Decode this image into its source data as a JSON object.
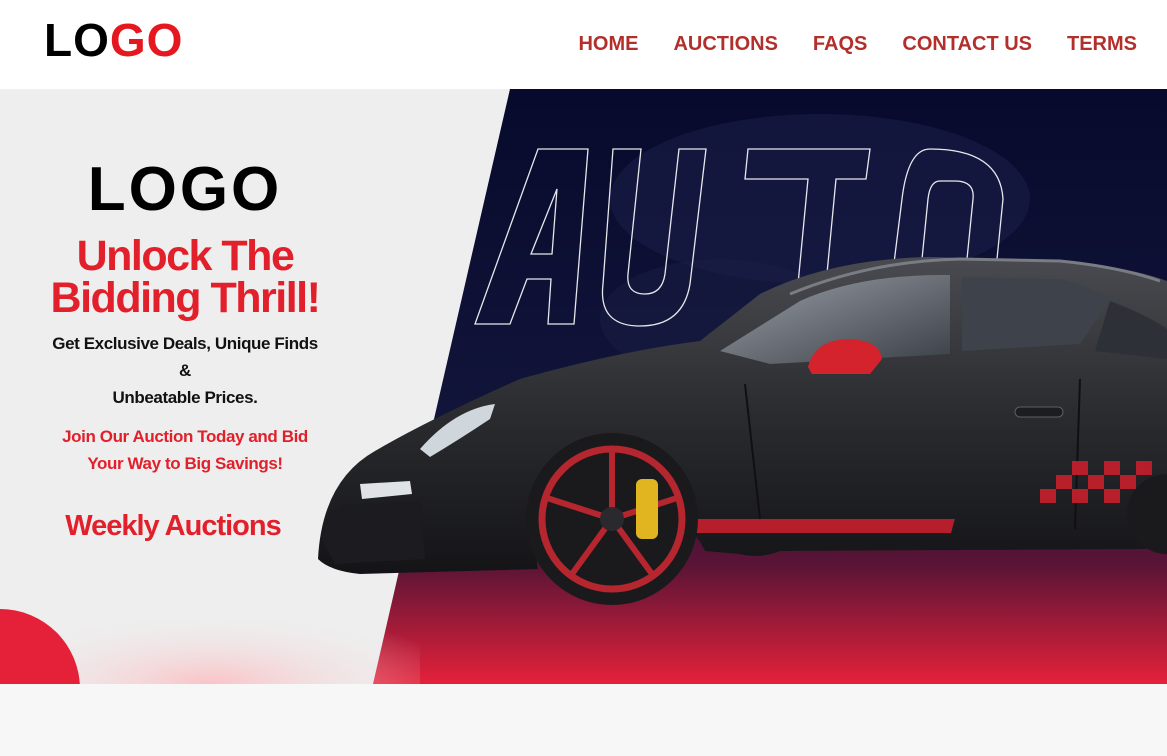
{
  "header": {
    "logo_part1": "LO",
    "logo_part2": "GO",
    "nav": [
      "HOME",
      "AUCTIONS",
      "FAQS",
      "CONTACT US",
      "TERMS"
    ]
  },
  "hero": {
    "logo_text": "LOGO",
    "tagline_line1": "Unlock The",
    "tagline_line2": "Bidding Thrill!",
    "sub_line1": "Get Exclusive Deals, Unique Finds",
    "sub_line2": "&",
    "sub_line3": "Unbeatable Prices.",
    "promo_line1": "Join Our Auction Today and Bid",
    "promo_line2": "Your Way to Big Savings!",
    "weekly": "Weekly Auctions",
    "watermark": "AUTO"
  },
  "colors": {
    "accent_red": "#e2202c",
    "nav_red": "#b2302c",
    "navy": "#0b0f2e",
    "panel_gray": "#eeeeee"
  }
}
